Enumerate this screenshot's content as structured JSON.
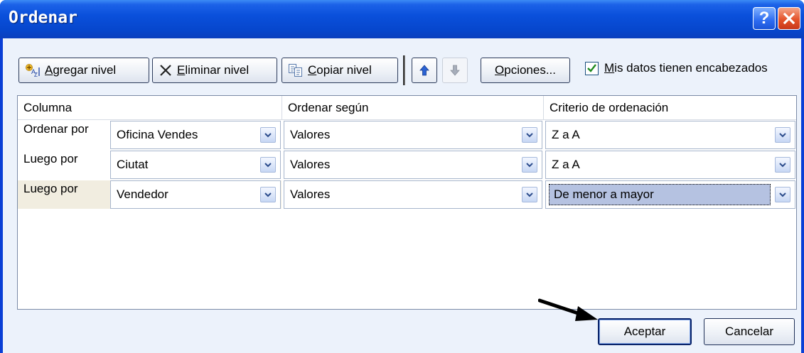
{
  "window": {
    "title": "Ordenar",
    "help_glyph": "?",
    "close_icon": "close-icon"
  },
  "toolbar": {
    "add_level": {
      "icon": "add-level-icon",
      "accel": "A",
      "rest": "gregar nivel"
    },
    "delete_level": {
      "icon": "x-icon",
      "accel": "E",
      "rest": "liminar nivel"
    },
    "copy_level": {
      "icon": "copy-icon",
      "accel": "C",
      "rest": "opiar nivel"
    },
    "move_up": {
      "icon": "arrow-up-icon"
    },
    "move_down": {
      "icon": "arrow-down-icon"
    },
    "options": {
      "accel": "O",
      "rest": "pciones..."
    },
    "headers_checkbox": {
      "checked": true,
      "accel": "M",
      "rest": "is datos tienen encabezados"
    }
  },
  "grid": {
    "headers": [
      "Columna",
      "Ordenar según",
      "Criterio de ordenación"
    ],
    "rows": [
      {
        "label": "Ordenar por",
        "column": "Oficina Vendes",
        "sort_on": "Valores",
        "order": "Z a A"
      },
      {
        "label": "Luego por",
        "column": "Ciutat",
        "sort_on": "Valores",
        "order": "Z a A"
      },
      {
        "label": "Luego por",
        "column": "Vendedor",
        "sort_on": "Valores",
        "order": "De menor a mayor"
      }
    ]
  },
  "buttons": {
    "ok": "Aceptar",
    "cancel": "Cancelar"
  },
  "colors": {
    "title_bar": "#0646cc",
    "client_bg": "#ecf2fb",
    "selected_row": "#f1ede0",
    "focus_highlight": "#b5c2e1"
  }
}
